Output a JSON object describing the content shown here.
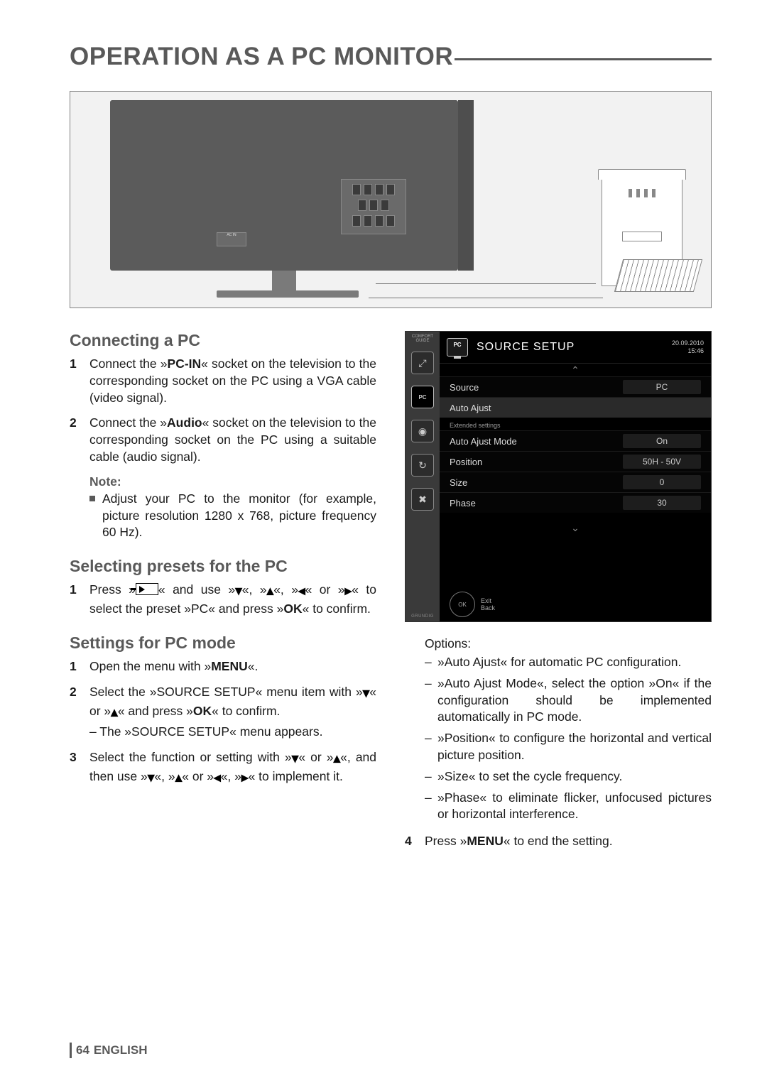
{
  "title": "OPERATION AS A PC MONITOR",
  "diagram": {
    "acin_label": "AC IN",
    "warning_glyph": "⚠"
  },
  "left_col": {
    "h_connecting": "Connecting a PC",
    "connecting_steps": [
      "Connect the »<b class='key'>PC-IN</b>« socket on the television to the corresponding socket on the PC using a VGA cable (video signal).",
      "Connect the »<b class='key'>Audio</b>« socket on the television to the corresponding socket on the PC using a suitable cable (audio signal)."
    ],
    "note_label": "Note:",
    "note_text": "Adjust your PC to the monitor (for example, picture resolution 1280 x 768, picture frequency 60 Hz).",
    "h_presets": "Selecting presets for the PC",
    "presets_steps": [
      "Press »<span class='source-btn'></span>« and use »<span class='glyph arrow-down'></span>«, »<span class='glyph arrow-up'></span>«, »<span class='glyph arrow-left'></span>« or »<span class='glyph arrow-right'></span>« to select the preset »PC« and press »<b class='key'>OK</b>« to confirm."
    ],
    "h_settings": "Settings for PC mode",
    "settings_steps": [
      "Open the menu with »<b class='key'>MENU</b>«.",
      "Select the »SOURCE SETUP« menu item with »<span class='glyph arrow-down'></span>« or »<span class='glyph arrow-up'></span>« and press »<b class='key'>OK</b>« to confirm.<span class='sub'>The »SOURCE SETUP« menu appears.</span>",
      "Select the function or setting with »<span class='glyph arrow-down'></span>« or »<span class='glyph arrow-up'></span>«, and then use »<span class='glyph arrow-down'></span>«, »<span class='glyph arrow-up'></span>« or »<span class='glyph arrow-left'></span>«, »<span class='glyph arrow-right'></span>« to implement it."
    ]
  },
  "osd": {
    "comfort_guide": "COMFORT GUIDE",
    "brand": "GRUNDIG",
    "title": "SOURCE SETUP",
    "pc_icon_label": "PC",
    "date_line1": "20.09.2010",
    "date_line2": "15:46",
    "rows": [
      {
        "label": "Source",
        "value": "PC",
        "highlight": false
      },
      {
        "label": "Auto Ajust",
        "value": "",
        "highlight": true
      }
    ],
    "section_label": "Extended settings",
    "ext_rows": [
      {
        "label": "Auto Ajust Mode",
        "value": "On"
      },
      {
        "label": "Position",
        "value": "50H - 50V"
      },
      {
        "label": "Size",
        "value": "0"
      },
      {
        "label": "Phase",
        "value": "30"
      }
    ],
    "footer_ok": "OK",
    "footer_exit": "Exit",
    "footer_back": "Back",
    "side_icons": [
      "⤢",
      "PC",
      "◎",
      "↻",
      "✖"
    ]
  },
  "right_col": {
    "options_label": "Options:",
    "options": [
      "»Auto Ajust« for automatic PC configuration.",
      "»Auto Ajust Mode«, select the option »On« if the configuration should be implemented automatically in PC mode.",
      "»Position« to configure the horizontal and vertical picture position.",
      "»Size« to set the cycle frequency.",
      "»Phase« to eliminate flicker, unfocused pictures or horizontal interference."
    ],
    "step4": "Press »<b class='key'>MENU</b>« to end the setting."
  },
  "footer": {
    "page": "64",
    "lang": "ENGLISH"
  }
}
